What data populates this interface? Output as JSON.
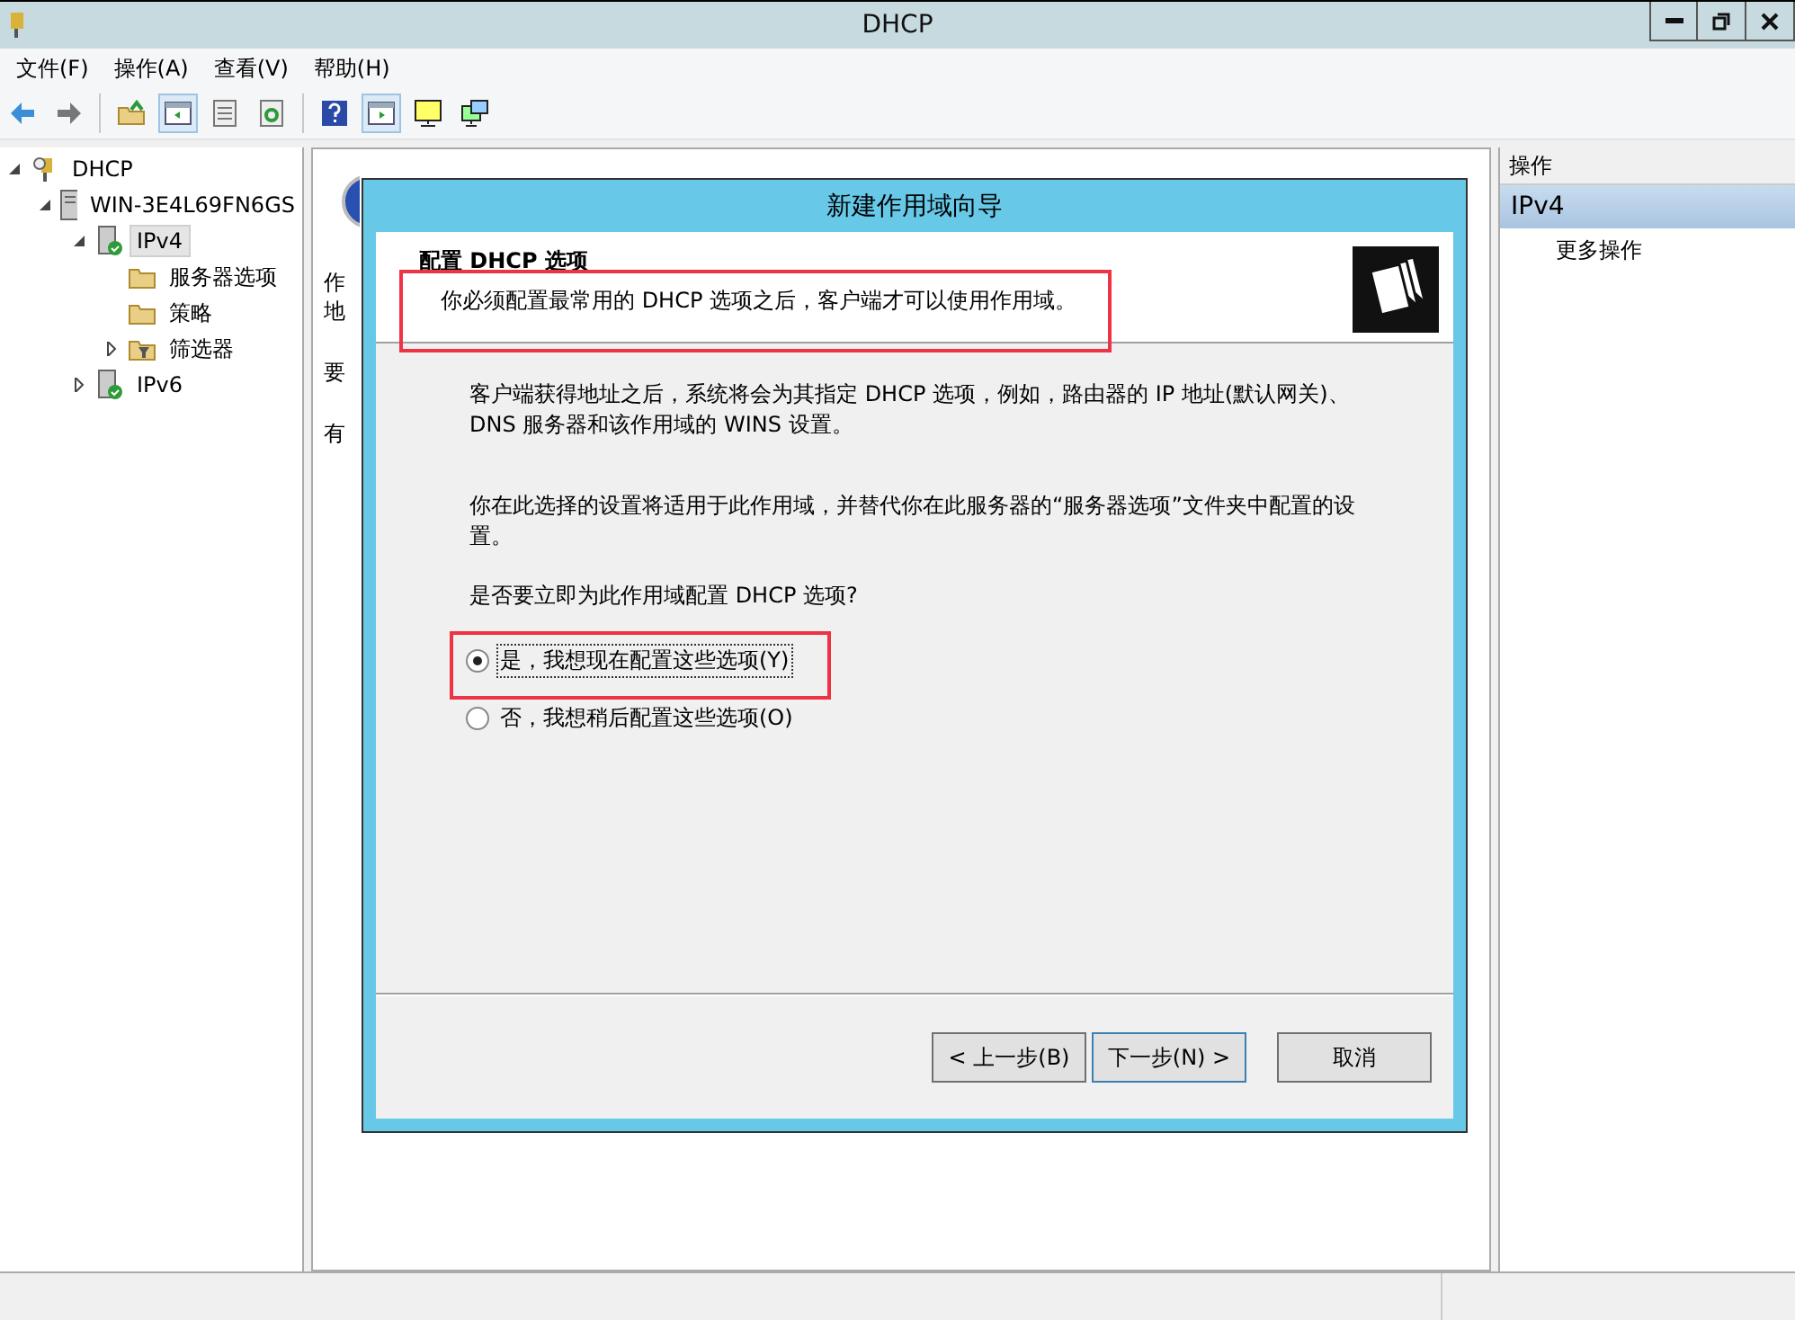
{
  "window": {
    "title": "DHCP"
  },
  "menu": [
    "文件(F)",
    "操作(A)",
    "查看(V)",
    "帮助(H)"
  ],
  "tree": [
    {
      "label": "DHCP",
      "kind": "dhcp",
      "selected": false,
      "expanded": true,
      "children": [
        {
          "label": "WIN-3E4L69FN6GS",
          "kind": "server",
          "selected": false,
          "expanded": true,
          "children": [
            {
              "label": "IPv4",
              "kind": "ip",
              "selected": true,
              "expanded": true,
              "children": [
                {
                  "label": "服务器选项",
                  "kind": "folder",
                  "selected": false
                },
                {
                  "label": "策略",
                  "kind": "folder",
                  "selected": false
                },
                {
                  "label": "筛选器",
                  "kind": "filter",
                  "selected": false,
                  "expanded": false
                }
              ]
            },
            {
              "label": "IPv6",
              "kind": "ip",
              "selected": false,
              "expanded": false
            }
          ]
        }
      ]
    }
  ],
  "middle_pane": {
    "fragments": [
      "作",
      "地",
      "要",
      "有"
    ]
  },
  "dialog": {
    "title": "新建作用域向导",
    "heading": "配置 DHCP 选项",
    "subheading": "你必须配置最常用的 DHCP 选项之后，客户端才可以使用作用域。",
    "paragraphs": [
      "客户端获得地址之后，系统将会为其指定 DHCP 选项，例如，路由器的 IP 地址(默认网关)、DNS 服务器和该作用域的 WINS 设置。",
      "你在此选择的设置将适用于此作用域，并替代你在此服务器的“服务器选项”文件夹中配置的设置。"
    ],
    "question": "是否要立即为此作用域配置 DHCP 选项?",
    "options": [
      {
        "label": "是，我想现在配置这些选项(Y)",
        "selected": true
      },
      {
        "label": "否，我想稍后配置这些选项(O)",
        "selected": false
      }
    ],
    "buttons": [
      {
        "label": "< 上一步(B)",
        "default": false
      },
      {
        "label": "下一步(N) >",
        "default": true
      },
      {
        "label": "取消",
        "default": false
      }
    ]
  },
  "actions": {
    "header": "操作",
    "section": "IPv4",
    "items": [
      "更多操作"
    ]
  }
}
